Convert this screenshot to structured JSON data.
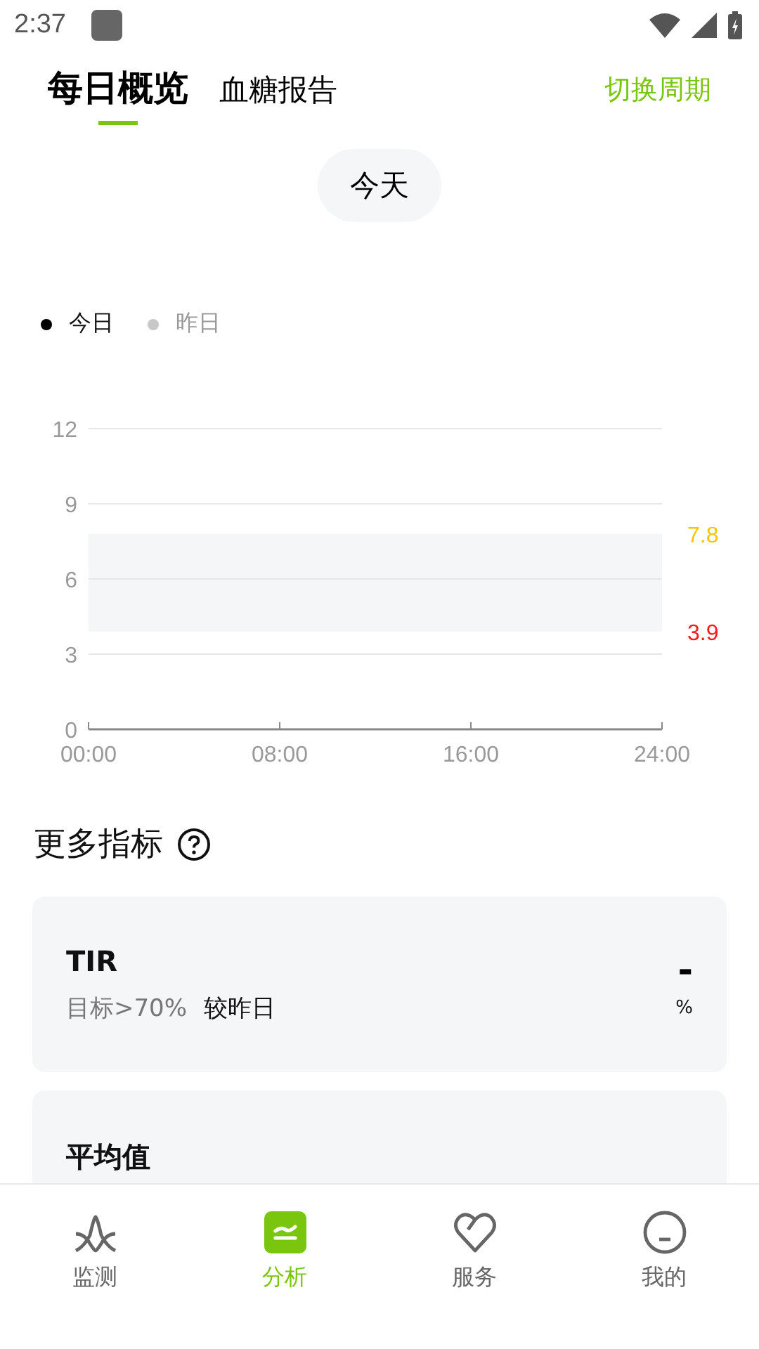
{
  "status_bar": {
    "time": "2:37"
  },
  "tabs": [
    {
      "label": "每日概览",
      "selected": true
    },
    {
      "label": "血糖报告",
      "selected": false
    }
  ],
  "switch_period": "切换周期",
  "date_pill": "今天",
  "legend": [
    {
      "label": "今日",
      "color": "#000000"
    },
    {
      "label": "昨日",
      "color": "#c8c8c8"
    }
  ],
  "chart": {
    "chart_data": {
      "type": "line",
      "x": [
        "00:00",
        "08:00",
        "16:00",
        "24:00"
      ],
      "ylim": [
        0,
        12
      ],
      "yticks": [
        0,
        3,
        6,
        9,
        12
      ],
      "grid": true,
      "bands": [
        {
          "axis": "y",
          "from": 3.9,
          "to": 7.8
        }
      ],
      "annotations": [
        "7.8",
        "3.9"
      ]
    },
    "limit_labels": [
      {
        "color": "#f5c400"
      },
      {
        "color": "#ff1a1a"
      }
    ]
  },
  "more_metrics": {
    "title": "更多指标"
  },
  "cards": [
    {
      "title": "TIR",
      "target": "目标>70%",
      "compare": "较昨日",
      "value": "-",
      "unit": "%"
    },
    {
      "title": "平均值"
    }
  ],
  "bottom_nav": [
    {
      "label": "监测",
      "kind": "monitor",
      "selected": false
    },
    {
      "label": "分析",
      "kind": "analysis",
      "selected": true
    },
    {
      "label": "服务",
      "kind": "service",
      "selected": false
    },
    {
      "label": "我的",
      "kind": "profile",
      "selected": false
    }
  ]
}
